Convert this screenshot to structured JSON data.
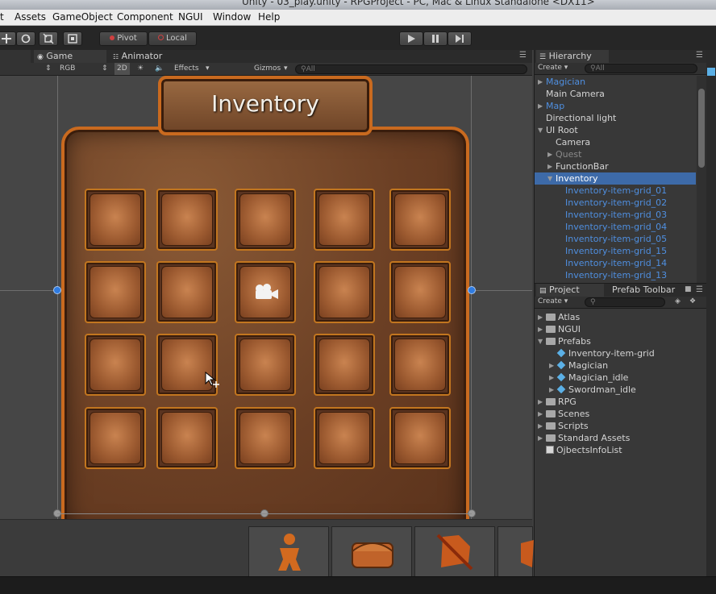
{
  "window": {
    "title": "Unity - 03_play.unity - RPGProject - PC, Mac & Linux Standalone <DX11>"
  },
  "menu": [
    "t",
    "Assets",
    "GameObject",
    "Component",
    "NGUI",
    "Window",
    "Help"
  ],
  "toolbar": {
    "pivot": "Pivot",
    "local": "Local"
  },
  "game_tabs": {
    "game": "Game",
    "animator": "Animator"
  },
  "game_bar": {
    "rgb": "RGB",
    "twod": "2D",
    "effects": "Effects",
    "gizmos": "Gizmos",
    "search_placeholder": "All"
  },
  "inventory": {
    "title": "Inventory",
    "rows": 4,
    "cols": 5
  },
  "hierarchy": {
    "tab": "Hierarchy",
    "create": "Create",
    "search_placeholder": "All",
    "items": [
      {
        "label": "Magician",
        "color": "#4f8fe0",
        "indent": 0,
        "arrow": "right"
      },
      {
        "label": "Main Camera",
        "color": "#d4d4d4",
        "indent": 0,
        "arrow": ""
      },
      {
        "label": "Map",
        "color": "#4f8fe0",
        "indent": 0,
        "arrow": "right"
      },
      {
        "label": "Directional light",
        "color": "#d4d4d4",
        "indent": 0,
        "arrow": ""
      },
      {
        "label": "UI Root",
        "color": "#d4d4d4",
        "indent": 0,
        "arrow": "down"
      },
      {
        "label": "Camera",
        "color": "#d4d4d4",
        "indent": 1,
        "arrow": ""
      },
      {
        "label": "Quest",
        "color": "#8a8a8a",
        "indent": 1,
        "arrow": "right"
      },
      {
        "label": "FunctionBar",
        "color": "#d4d4d4",
        "indent": 1,
        "arrow": "right"
      },
      {
        "label": "Inventory",
        "color": "#ffffff",
        "indent": 1,
        "arrow": "down",
        "selected": true
      },
      {
        "label": "Inventory-item-grid_01",
        "color": "#4f8fe0",
        "indent": 2,
        "arrow": ""
      },
      {
        "label": "Inventory-item-grid_02",
        "color": "#4f8fe0",
        "indent": 2,
        "arrow": ""
      },
      {
        "label": "Inventory-item-grid_03",
        "color": "#4f8fe0",
        "indent": 2,
        "arrow": ""
      },
      {
        "label": "Inventory-item-grid_04",
        "color": "#4f8fe0",
        "indent": 2,
        "arrow": ""
      },
      {
        "label": "Inventory-item-grid_05",
        "color": "#4f8fe0",
        "indent": 2,
        "arrow": ""
      },
      {
        "label": "Inventory-item-grid_15",
        "color": "#4f8fe0",
        "indent": 2,
        "arrow": ""
      },
      {
        "label": "Inventory-item-grid_14",
        "color": "#4f8fe0",
        "indent": 2,
        "arrow": ""
      },
      {
        "label": "Inventory-item-grid_13",
        "color": "#4f8fe0",
        "indent": 2,
        "arrow": ""
      }
    ]
  },
  "project": {
    "tab": "Project",
    "tab2": "Prefab Toolbar",
    "create": "Create",
    "items": [
      {
        "label": "Atlas",
        "type": "folder",
        "indent": 0,
        "arrow": "right"
      },
      {
        "label": "NGUI",
        "type": "folder",
        "indent": 0,
        "arrow": "right"
      },
      {
        "label": "Prefabs",
        "type": "folder",
        "indent": 0,
        "arrow": "down"
      },
      {
        "label": "Inventory-item-grid",
        "type": "prefab",
        "indent": 1,
        "arrow": ""
      },
      {
        "label": "Magician",
        "type": "prefab",
        "indent": 1,
        "arrow": "right"
      },
      {
        "label": "Magician_idle",
        "type": "prefab",
        "indent": 1,
        "arrow": "right"
      },
      {
        "label": "Swordman_idle",
        "type": "prefab",
        "indent": 1,
        "arrow": "right"
      },
      {
        "label": "RPG",
        "type": "folder",
        "indent": 0,
        "arrow": "right"
      },
      {
        "label": "Scenes",
        "type": "folder",
        "indent": 0,
        "arrow": "right"
      },
      {
        "label": "Scripts",
        "type": "folder",
        "indent": 0,
        "arrow": "right"
      },
      {
        "label": "Standard Assets",
        "type": "folder",
        "indent": 0,
        "arrow": "right"
      },
      {
        "label": "OjbectsInfoList",
        "type": "scene",
        "indent": 0,
        "arrow": ""
      }
    ]
  },
  "function_bar": [
    "status",
    "bag",
    "equipment",
    "skill"
  ],
  "colors": {
    "accent": "#3d6aa8",
    "frame": "#c96a1f",
    "handle": "#2f7be0"
  }
}
